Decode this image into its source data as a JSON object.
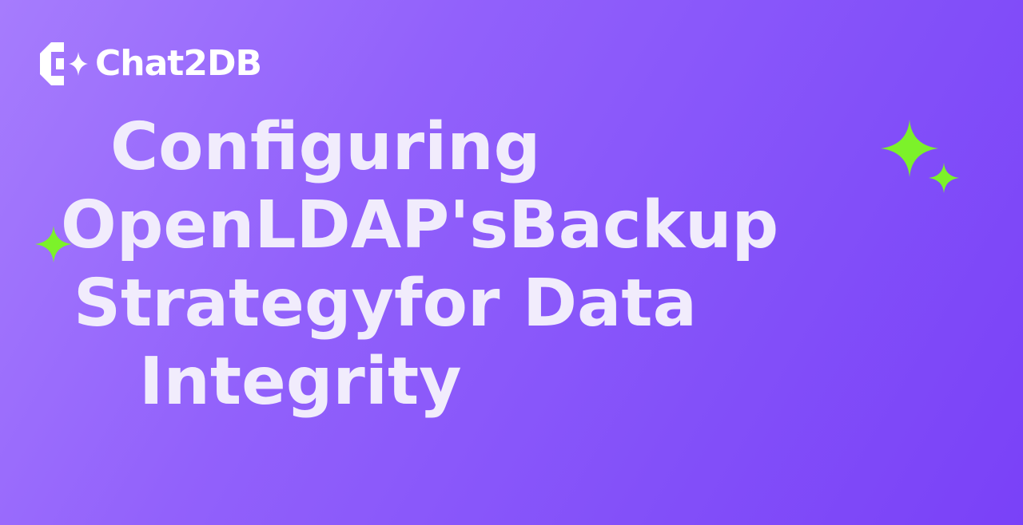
{
  "brand": {
    "name": "Chat2DB",
    "logo_icon": "chat2db-logo-icon"
  },
  "title": {
    "lines": [
      "Configuring",
      "OpenLDAP'sBackup",
      "Strategyfor Data",
      "Integrity"
    ]
  },
  "decorations": {
    "sparkle_icon": "sparkle-icon",
    "sparkle_color": "#7cf22a",
    "text_color": "#f1ecfc",
    "background_start": "#a67cfd",
    "background_end": "#7a41f8"
  }
}
